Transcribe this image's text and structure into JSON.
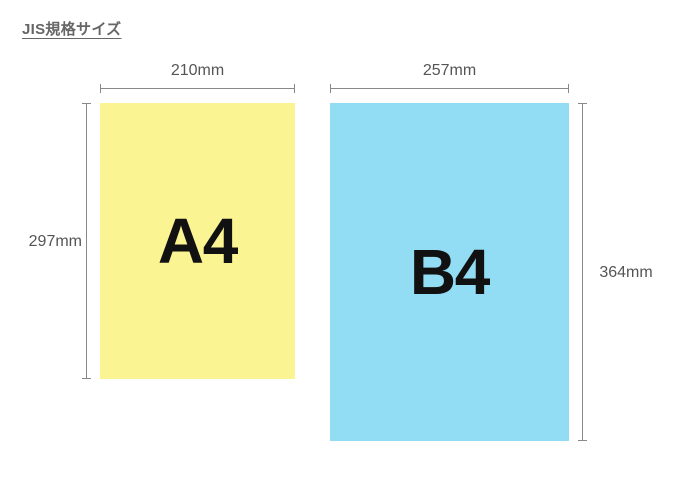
{
  "title": "JIS規格サイズ",
  "a4": {
    "name": "A4",
    "width_label": "210mm",
    "height_label": "297mm",
    "width_mm": 210,
    "height_mm": 297,
    "color": "#fbf492"
  },
  "b4": {
    "name": "B4",
    "width_label": "257mm",
    "height_label": "364mm",
    "width_mm": 257,
    "height_mm": 364,
    "color": "#92dcf4"
  }
}
